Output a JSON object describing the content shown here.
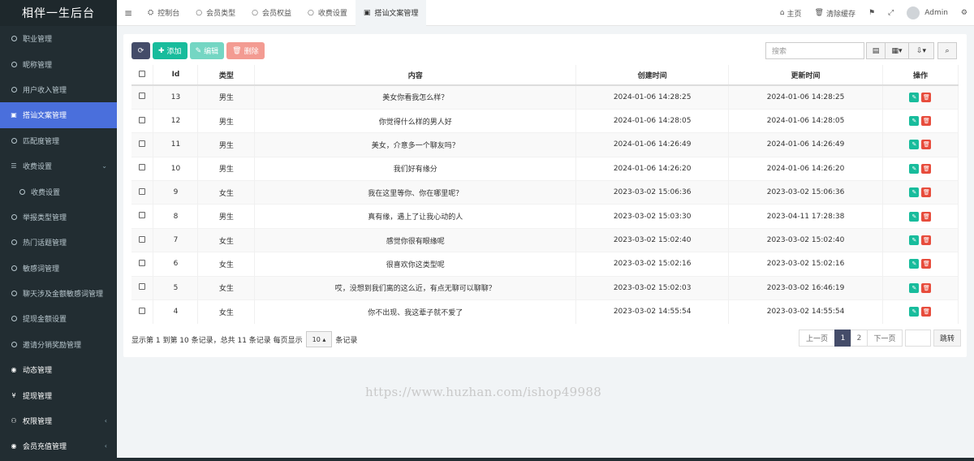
{
  "app": {
    "title": "相伴一生后台"
  },
  "sidebar": {
    "items": [
      {
        "label": "职业管理",
        "type": "item"
      },
      {
        "label": "昵称管理",
        "type": "item"
      },
      {
        "label": "用户收入管理",
        "type": "item"
      },
      {
        "label": "搭讪文案管理",
        "type": "active"
      },
      {
        "label": "匹配度管理",
        "type": "item"
      },
      {
        "label": "收费设置",
        "type": "expand"
      },
      {
        "label": "收费设置",
        "type": "sub"
      },
      {
        "label": "举报类型管理",
        "type": "item"
      },
      {
        "label": "热门话题管理",
        "type": "item"
      },
      {
        "label": "敏感词管理",
        "type": "item"
      },
      {
        "label": "聊天涉及金额敏感词管理",
        "type": "item"
      },
      {
        "label": "提现金额设置",
        "type": "item"
      },
      {
        "label": "邀请分销奖励管理",
        "type": "item"
      },
      {
        "label": "动态管理",
        "type": "group"
      },
      {
        "label": "提现管理",
        "type": "group"
      },
      {
        "label": "权限管理",
        "type": "group-caret"
      },
      {
        "label": "会员充值管理",
        "type": "group-caret"
      }
    ]
  },
  "topbar": {
    "tabs": [
      {
        "label": "控制台",
        "icon": "dashboard-icon"
      },
      {
        "label": "会员类型",
        "icon": "circle-icon"
      },
      {
        "label": "会员权益",
        "icon": "circle-icon"
      },
      {
        "label": "收费设置",
        "icon": "circle-icon"
      },
      {
        "label": "搭讪文案管理",
        "icon": "app-icon"
      }
    ],
    "home_label": "主页",
    "clear_cache_label": "清除缓存",
    "user_name": "Admin"
  },
  "toolbar": {
    "add_label": "添加",
    "edit_label": "编辑",
    "delete_label": "删除",
    "search_placeholder": "搜索"
  },
  "table": {
    "headers": [
      "Id",
      "类型",
      "内容",
      "创建时间",
      "更新时间",
      "操作"
    ],
    "rows": [
      {
        "id": "13",
        "type": "男生",
        "content": "美女你看我怎么样？",
        "created": "2024-01-06 14:28:25",
        "updated": "2024-01-06 14:28:25"
      },
      {
        "id": "12",
        "type": "男生",
        "content": "你觉得什么样的男人好",
        "created": "2024-01-06 14:28:05",
        "updated": "2024-01-06 14:28:05"
      },
      {
        "id": "11",
        "type": "男生",
        "content": "美女，介意多一个聊友吗？",
        "created": "2024-01-06 14:26:49",
        "updated": "2024-01-06 14:26:49"
      },
      {
        "id": "10",
        "type": "男生",
        "content": "我们好有缘分",
        "created": "2024-01-06 14:26:20",
        "updated": "2024-01-06 14:26:20"
      },
      {
        "id": "9",
        "type": "女生",
        "content": "我在这里等你、你在哪里呢？",
        "created": "2023-03-02 15:06:36",
        "updated": "2023-03-02 15:06:36"
      },
      {
        "id": "8",
        "type": "男生",
        "content": "真有缘，遇上了让我心动的人",
        "created": "2023-03-02 15:03:30",
        "updated": "2023-04-11 17:28:38"
      },
      {
        "id": "7",
        "type": "女生",
        "content": "感觉你很有眼缘呢",
        "created": "2023-03-02 15:02:40",
        "updated": "2023-03-02 15:02:40"
      },
      {
        "id": "6",
        "type": "女生",
        "content": "很喜欢你这类型呢",
        "created": "2023-03-02 15:02:16",
        "updated": "2023-03-02 15:02:16"
      },
      {
        "id": "5",
        "type": "女生",
        "content": "哎，没想到我们离的这么近，有点无聊可以聊聊？",
        "created": "2023-03-02 15:02:03",
        "updated": "2023-03-02 16:46:19"
      },
      {
        "id": "4",
        "type": "女生",
        "content": "你不出现、我这辈子就不爱了",
        "created": "2023-03-02 14:55:54",
        "updated": "2023-03-02 14:55:54"
      }
    ]
  },
  "pagination": {
    "info_prefix": "显示第 1 到第 10 条记录，总共 11 条记录 每页显示",
    "page_size": "10",
    "info_suffix": "条记录",
    "prev_label": "上一页",
    "pages": [
      "1",
      "2"
    ],
    "current_page": "1",
    "next_label": "下一页",
    "goto_label": "跳转"
  },
  "watermark": "https://www.huzhan.com/ishop49988",
  "colors": {
    "sidebar_bg": "#222d32",
    "active_item": "#4a6fdc",
    "male": "#18bc9c",
    "primary_dark": "#444c69"
  }
}
